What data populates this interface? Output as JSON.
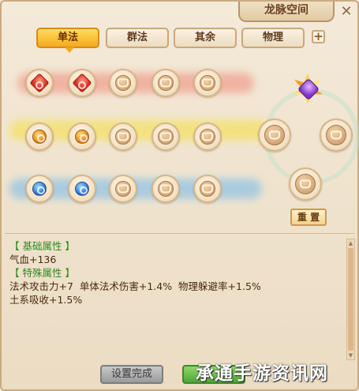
{
  "window": {
    "title": "龙脉空间",
    "close_icon": "close-icon"
  },
  "tabs": [
    {
      "label": "单法",
      "active": true
    },
    {
      "label": "群法",
      "active": false
    },
    {
      "label": "其余",
      "active": false
    },
    {
      "label": "物理",
      "active": false
    }
  ],
  "add_tab": {
    "label": "+"
  },
  "grid": {
    "rows": [
      {
        "trail_color": "#e86a5a",
        "nodes": [
          "red-gem",
          "red-gem",
          "locked",
          "locked",
          "locked"
        ]
      },
      {
        "trail_color": "#f5d400",
        "nodes": [
          "gold-gem",
          "gold-gem",
          "locked",
          "locked",
          "locked"
        ]
      },
      {
        "trail_color": "#4aa6e8",
        "nodes": [
          "blue-gem",
          "blue-gem",
          "locked",
          "locked",
          "locked"
        ]
      }
    ],
    "side_nodes": [
      "purple-star-gem",
      "locked",
      "locked",
      "locked"
    ]
  },
  "reset_button": {
    "label": "重 置"
  },
  "attributes": {
    "basic_header": "【 基础属性 】",
    "basic_lines": [
      "气血+136"
    ],
    "special_header": "【 特殊属性 】",
    "special_lines": [
      "法术攻击力+7  单体法术伤害+1.4%  物理躲避率+1.5%",
      "土系吸收+1.5%"
    ]
  },
  "footer": {
    "done_button": "设置完成"
  },
  "watermark": "承通手游资讯网",
  "colors": {
    "accent_tab": "#f4aa1e",
    "attr_header": "#2e8b1f"
  }
}
